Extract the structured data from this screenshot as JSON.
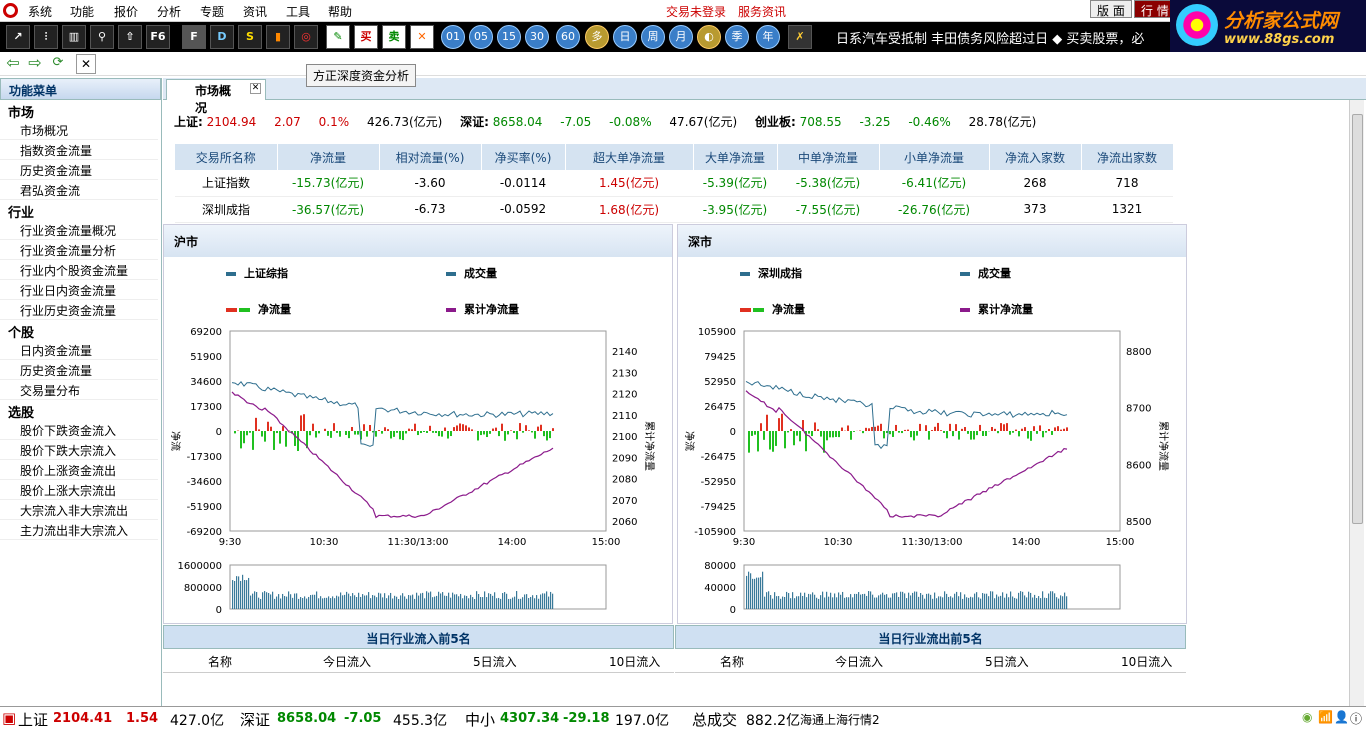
{
  "menubar": {
    "items": [
      "系统",
      "功能",
      "报价",
      "分析",
      "专题",
      "资讯",
      "工具",
      "帮助"
    ],
    "login": "交易未登录",
    "service": "服务资讯",
    "tab_layout": "版 面",
    "tab_quote": "行 情"
  },
  "toolbar": {
    "f6": "F6",
    "buy": "买",
    "sell": "卖",
    "circles": [
      "01",
      "05",
      "15",
      "30",
      "60",
      "多",
      "日",
      "周",
      "月",
      "季",
      "年"
    ],
    "ticker": "日系汽车受抵制  丰田债务风险超过日 ◆  买卖股票，必"
  },
  "brand": {
    "name": "分析家公式网",
    "url": "www.88gs.com"
  },
  "tooltip": "方正深度资金分析",
  "sidebar": {
    "title": "功能菜单",
    "groups": [
      {
        "name": "市场",
        "items": [
          "市场概况",
          "指数资金流量",
          "历史资金流量",
          "君弘资金流"
        ]
      },
      {
        "name": "行业",
        "items": [
          "行业资金流量概况",
          "行业资金流量分析",
          "行业内个股资金流量",
          "行业日内资金流量",
          "行业历史资金流量"
        ]
      },
      {
        "name": "个股",
        "items": [
          "日内资金流量",
          "历史资金流量",
          "交易量分布"
        ]
      },
      {
        "name": "选股",
        "items": [
          "股价下跌资金流入",
          "股价下跌大宗流入",
          "股价上涨资金流出",
          "股价上涨大宗流出",
          "大宗流入非大宗流出",
          "主力流出非大宗流入"
        ]
      }
    ]
  },
  "tab": {
    "label": "市场概况"
  },
  "summary": {
    "sh_label": "上证:",
    "sh_val": "2104.94",
    "sh_chg": "2.07",
    "sh_pct": "0.1%",
    "sh_amt": "426.73(亿元)",
    "sz_label": "深证:",
    "sz_val": "8658.04",
    "sz_chg": "-7.05",
    "sz_pct": "-0.08%",
    "sz_amt": "47.67(亿元)",
    "cy_label": "创业板:",
    "cy_val": "708.55",
    "cy_chg": "-3.25",
    "cy_pct": "-0.46%",
    "cy_amt": "28.78(亿元)"
  },
  "flow_table": {
    "headers": [
      "交易所名称",
      "净流量",
      "相对流量(%)",
      "净买率(%)",
      "超大单净流量",
      "大单净流量",
      "中单净流量",
      "小单净流量",
      "净流入家数",
      "净流出家数"
    ],
    "rows": [
      [
        "上证指数",
        "-15.73(亿元)",
        "-3.60",
        "-0.0114",
        "1.45(亿元)",
        "-5.39(亿元)",
        "-5.38(亿元)",
        "-6.41(亿元)",
        "268",
        "718"
      ],
      [
        "深圳成指",
        "-36.57(亿元)",
        "-6.73",
        "-0.0592",
        "1.68(亿元)",
        "-3.95(亿元)",
        "-7.55(亿元)",
        "-26.76(亿元)",
        "373",
        "1321"
      ]
    ]
  },
  "colors": {
    "index_line": "#2e6e8e",
    "cum_flow": "#8b1a8b",
    "inflow": "#e03020",
    "outflow": "#20c020",
    "volume": "#3a7a9a"
  },
  "chart_data": [
    {
      "type": "line",
      "title": "沪市",
      "series": [
        {
          "name": "上证综指"
        },
        {
          "name": "成交量"
        },
        {
          "name": "净流量"
        },
        {
          "name": "累计净流量"
        }
      ],
      "ylabel_left": "净流",
      "ylabel_right": "累计净流量",
      "y_left_ticks": [
        "69200",
        "51900",
        "34600",
        "17300",
        "0",
        "-17300",
        "-34600",
        "-51900",
        "-69200"
      ],
      "y_right_ticks": [
        "2140",
        "2130",
        "2120",
        "2110",
        "2100",
        "2090",
        "2080",
        "2070",
        "2060"
      ],
      "x_ticks": [
        "9:30",
        "10:30",
        "11:30/13:00",
        "14:00",
        "15:00"
      ],
      "vol_ticks": [
        "1600000",
        "800000",
        "0"
      ],
      "ylim_left": [
        -69200,
        69200
      ],
      "ylim_right": [
        2057,
        2143
      ]
    },
    {
      "type": "line",
      "title": "深市",
      "series": [
        {
          "name": "深圳成指"
        },
        {
          "name": "成交量"
        },
        {
          "name": "净流量"
        },
        {
          "name": "累计净流量"
        }
      ],
      "ylabel_left": "净流",
      "ylabel_right": "累计净流量",
      "y_left_ticks": [
        "105900",
        "79425",
        "52950",
        "26475",
        "0",
        "-26475",
        "-52950",
        "-79425",
        "-105900"
      ],
      "y_right_ticks": [
        "8800",
        "8700",
        "8600",
        "8500"
      ],
      "x_ticks": [
        "9:30",
        "10:30",
        "11:30/13:00",
        "14:00",
        "15:00"
      ],
      "vol_ticks": [
        "80000",
        "40000",
        "0"
      ],
      "ylim_left": [
        -105900,
        105900
      ],
      "ylim_right": [
        8470,
        8830
      ]
    }
  ],
  "bottom": {
    "inflow_title": "当日行业流入前5名",
    "outflow_title": "当日行业流出前5名",
    "cols": [
      "名称",
      "今日流入",
      "5日流入",
      "10日流入"
    ]
  },
  "statusbar": {
    "sh_label": "上证",
    "sh_val": "2104.41",
    "sh_chg": "1.54",
    "sh_amt": "427.0亿",
    "sz_label": "深证",
    "sz_val": "8658.04",
    "sz_chg": "-7.05",
    "sz_amt": "455.3亿",
    "zx_label": "中小",
    "zx_val": "4307.34",
    "zx_chg": "-29.18",
    "zx_amt": "197.0亿",
    "total_label": "总成交",
    "total_val": "882.2亿",
    "source": "海通上海行情2"
  }
}
